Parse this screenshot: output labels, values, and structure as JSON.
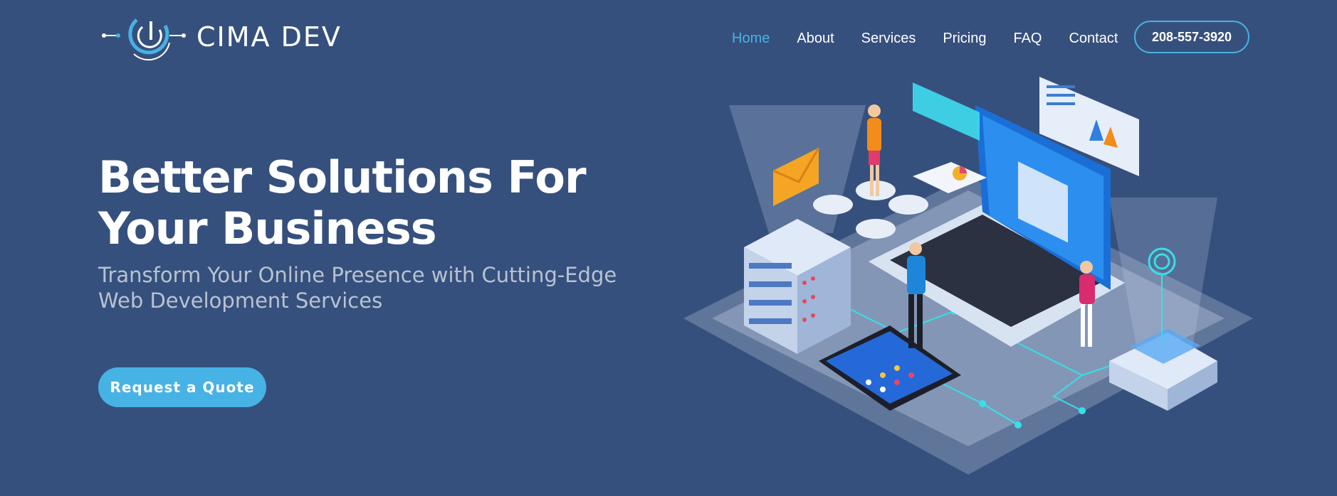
{
  "header": {
    "brand": "CIMA DEV",
    "logo_icon": "power-circuit-icon",
    "nav": [
      {
        "label": "Home",
        "active": true
      },
      {
        "label": "About",
        "active": false
      },
      {
        "label": "Services",
        "active": false
      },
      {
        "label": "Pricing",
        "active": false
      },
      {
        "label": "FAQ",
        "active": false
      },
      {
        "label": "Contact",
        "active": false
      }
    ],
    "phone": "208-557-3920"
  },
  "hero": {
    "title": "Better Solutions For Your Business",
    "subtitle": "Transform Your Online Presence with Cutting-Edge Web Development Services",
    "cta_label": "Request a Quote",
    "illustration": "isometric-web-development-illustration"
  },
  "colors": {
    "background": "#36507d",
    "accent": "#47b2e4",
    "text": "#ffffff"
  }
}
